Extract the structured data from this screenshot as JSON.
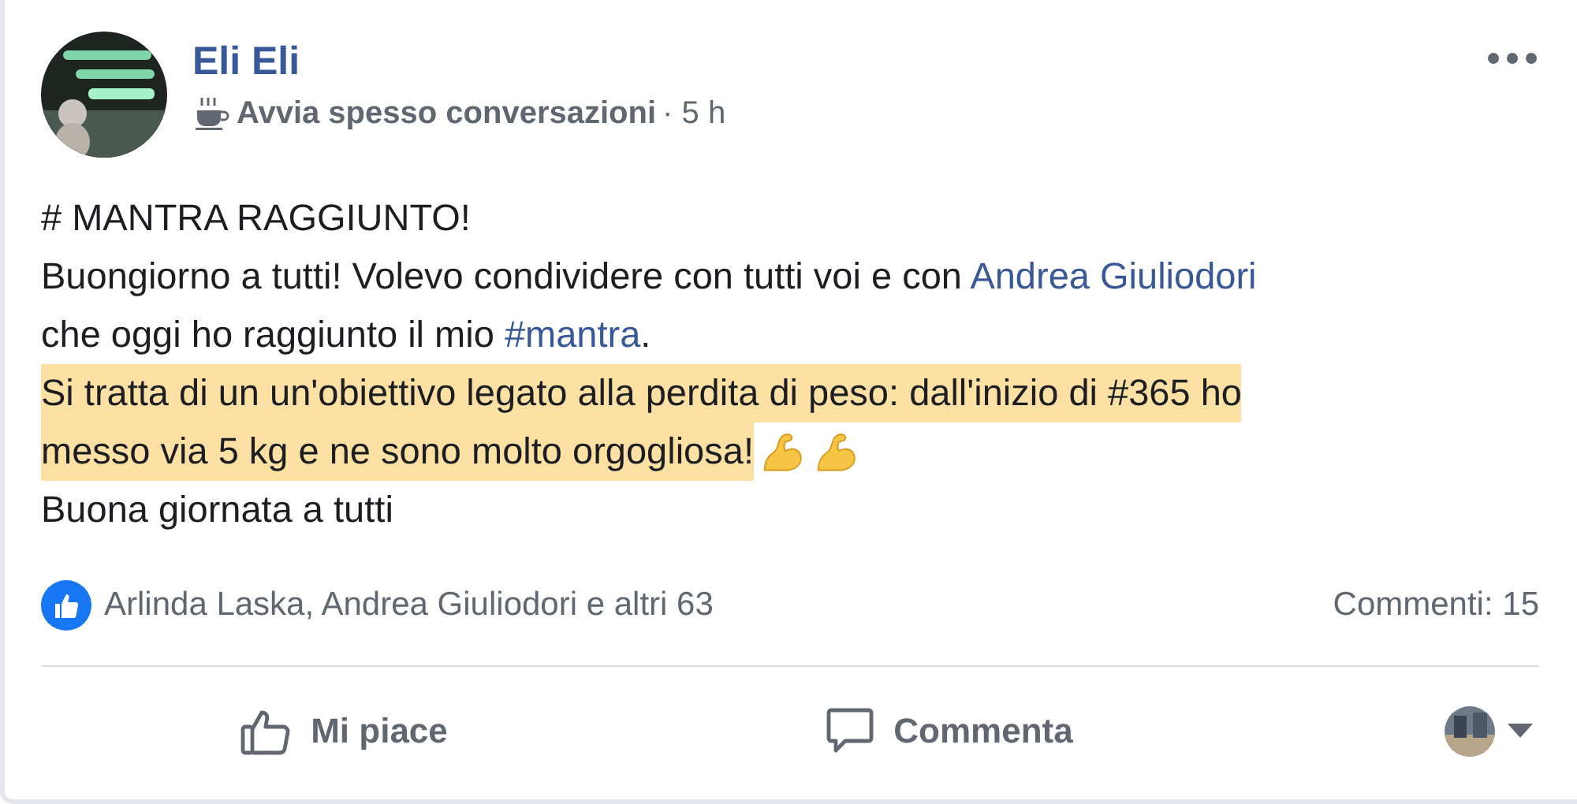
{
  "post": {
    "author": "Eli Eli",
    "badge": "Avvia spesso conversazioni",
    "time": "· 5 h",
    "paragraphs": [
      {
        "highlighted": false,
        "lines": [
          [
            {
              "kind": "text",
              "text": "# MANTRA RAGGIUNTO!"
            }
          ]
        ]
      },
      {
        "highlighted": false,
        "lines": [
          [
            {
              "kind": "text",
              "text": "Buongiorno a tutti! Volevo condividere con tutti voi e con "
            },
            {
              "kind": "link",
              "text": "Andrea Giuliodori"
            }
          ],
          [
            {
              "kind": "text",
              "text": "che oggi ho raggiunto il mio "
            },
            {
              "kind": "link",
              "text": "#mantra"
            },
            {
              "kind": "text",
              "text": "."
            }
          ]
        ]
      },
      {
        "highlighted": true,
        "lines": [
          [
            {
              "kind": "text",
              "text": "Si tratta di un un'obiettivo legato alla perdita di peso: dall'inizio di #365 ho"
            }
          ],
          [
            {
              "kind": "text",
              "text": "messo via 5 kg e ne sono molto orgogliosa!"
            },
            {
              "kind": "flex"
            },
            {
              "kind": "flex"
            }
          ]
        ]
      },
      {
        "highlighted": false,
        "lines": [
          [
            {
              "kind": "text",
              "text": "Buona giornata a tutti"
            }
          ]
        ]
      }
    ],
    "reactions": "Arlinda Laska, Andrea Giuliodori e altri 63",
    "comments": "Commenti: 15",
    "actions": [
      {
        "kind": "like",
        "label": "Mi piace"
      },
      {
        "kind": "comment",
        "label": "Commenta"
      }
    ]
  }
}
